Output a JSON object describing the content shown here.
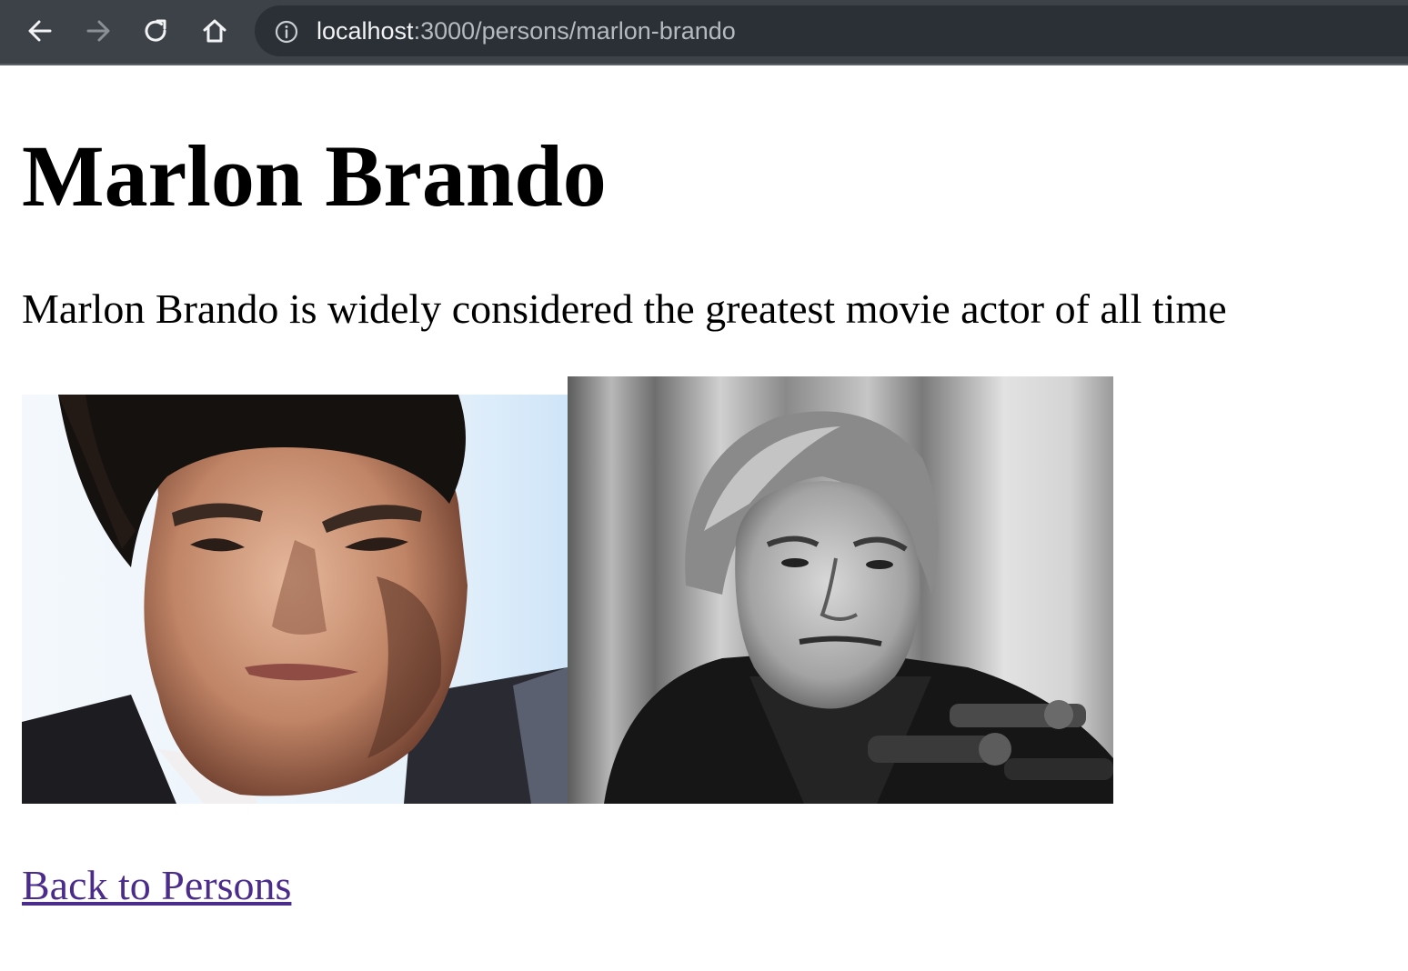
{
  "browser": {
    "url_host": "localhost",
    "url_rest": ":3000/persons/marlon-brando",
    "icons": [
      "back-arrow-icon",
      "forward-arrow-icon",
      "reload-icon",
      "home-icon",
      "info-icon"
    ]
  },
  "page": {
    "title": "Marlon Brando",
    "description": "Marlon Brando is widely considered the greatest movie actor of all time",
    "back_link": "Back to Persons",
    "link_color": "#4b2c8c"
  }
}
